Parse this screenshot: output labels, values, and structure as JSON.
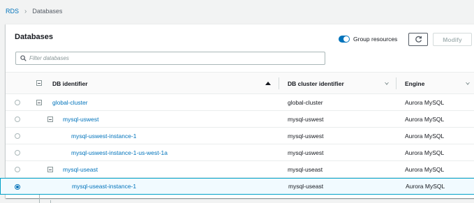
{
  "breadcrumb": {
    "root": "RDS",
    "current": "Databases"
  },
  "panel": {
    "title": "Databases",
    "group_toggle_label": "Group resources",
    "group_toggle_on": true,
    "modify_label": "Modify"
  },
  "search": {
    "placeholder": "Filter databases",
    "value": ""
  },
  "table": {
    "columns": {
      "db_identifier": "DB identifier",
      "cluster_identifier": "DB cluster identifier",
      "engine": "Engine"
    },
    "rows": [
      {
        "id": "global-cluster",
        "cluster": "global-cluster",
        "engine": "Aurora MySQL",
        "level": 0,
        "selected": false
      },
      {
        "id": "mysql-uswest",
        "cluster": "mysql-uswest",
        "engine": "Aurora MySQL",
        "level": 1,
        "selected": false
      },
      {
        "id": "mysql-uswest-instance-1",
        "cluster": "mysql-uswest",
        "engine": "Aurora MySQL",
        "level": 2,
        "selected": false
      },
      {
        "id": "mysql-uswest-instance-1-us-west-1a",
        "cluster": "mysql-uswest",
        "engine": "Aurora MySQL",
        "level": 2,
        "selected": false
      },
      {
        "id": "mysql-useast",
        "cluster": "mysql-useast",
        "engine": "Aurora MySQL",
        "level": 1,
        "selected": false
      },
      {
        "id": "mysql-useast-instance-1",
        "cluster": "mysql-useast",
        "engine": "Aurora MySQL",
        "level": 2,
        "selected": true
      }
    ]
  },
  "colors": {
    "link": "#0073bb",
    "selected_row_bg": "#f1faff",
    "selected_row_border": "#00a1c9"
  }
}
